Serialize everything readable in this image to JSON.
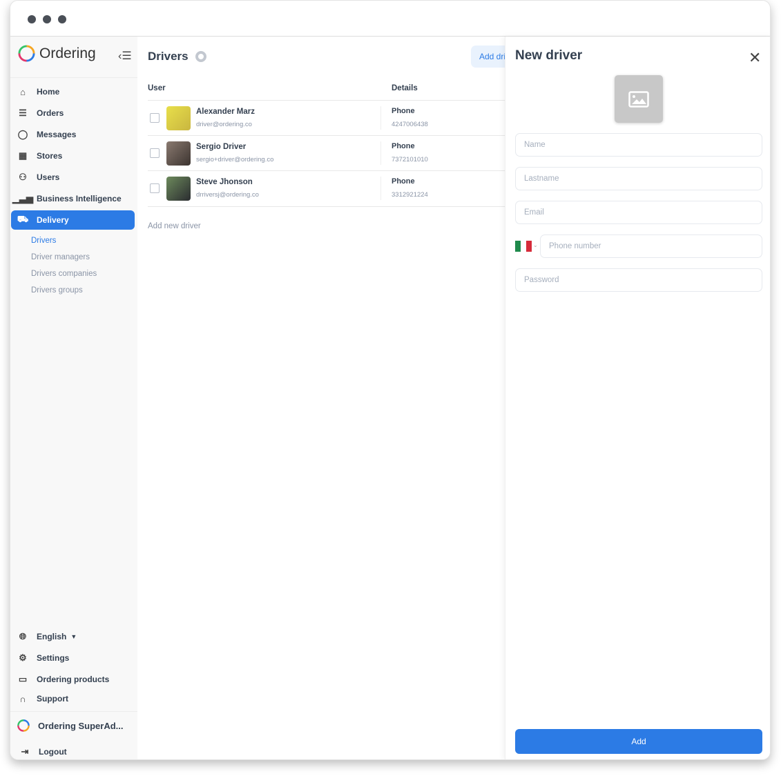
{
  "sidebar": {
    "brand": "Ordering",
    "items": [
      {
        "label": "Home",
        "icon": "home-icon"
      },
      {
        "label": "Orders",
        "icon": "list-icon"
      },
      {
        "label": "Messages",
        "icon": "chat-icon"
      },
      {
        "label": "Stores",
        "icon": "store-icon"
      },
      {
        "label": "Users",
        "icon": "users-icon"
      },
      {
        "label": "Business Intelligence",
        "icon": "bar-chart-icon"
      },
      {
        "label": "Delivery",
        "icon": "truck-icon",
        "active": true
      }
    ],
    "subitems": [
      "Drivers",
      "Driver managers",
      "Drivers companies",
      "Drivers groups"
    ],
    "bottom": {
      "language": "English",
      "settings": "Settings",
      "products": "Ordering products",
      "support": "Support",
      "account": "Ordering SuperAd...",
      "logout": "Logout"
    }
  },
  "main": {
    "title": "Drivers",
    "add_button": "Add driver",
    "columns": [
      "User",
      "Details"
    ],
    "rows": [
      {
        "name": "Alexander Marz",
        "email": "driver@ordering.co",
        "phone_label": "Phone",
        "phone": "4247006438"
      },
      {
        "name": "Sergio Driver",
        "email": "sergio+driver@ordering.co",
        "phone_label": "Phone",
        "phone": "7372101010"
      },
      {
        "name": "Steve Jhonson",
        "email": "drriversj@ordering.co",
        "phone_label": "Phone",
        "phone": "3312921224"
      }
    ],
    "add_new": "Add new driver"
  },
  "drawer": {
    "title": "New driver",
    "placeholders": {
      "name": "Name",
      "lastname": "Lastname",
      "email": "Email",
      "phone": "Phone number",
      "password": "Password"
    },
    "submit": "Add"
  },
  "colors": {
    "accent": "#2c7be5",
    "sidebar_bg": "#f8f8f8"
  }
}
